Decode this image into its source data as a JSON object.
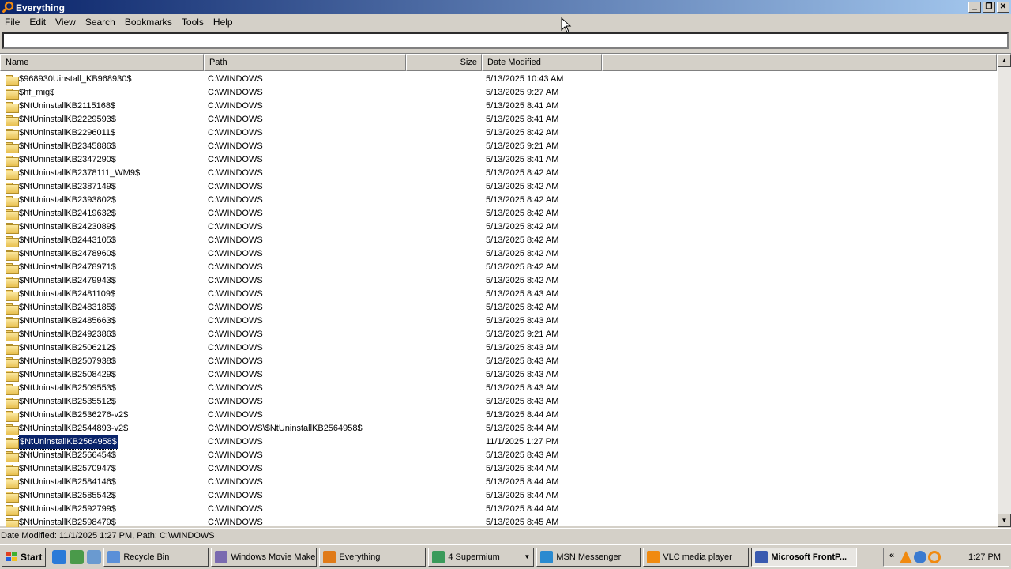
{
  "window": {
    "title": "Everything"
  },
  "menu": [
    "File",
    "Edit",
    "View",
    "Search",
    "Bookmarks",
    "Tools",
    "Help"
  ],
  "search": {
    "value": "",
    "placeholder": ""
  },
  "columns": {
    "name": "Name",
    "path": "Path",
    "size": "Size",
    "date": "Date Modified"
  },
  "rows": [
    {
      "name": "$968930Uinstall_KB968930$",
      "path": "C:\\WINDOWS",
      "date": "5/13/2025 10:43 AM"
    },
    {
      "name": "$hf_mig$",
      "path": "C:\\WINDOWS",
      "date": "5/13/2025 9:27 AM"
    },
    {
      "name": "$NtUninstallKB2115168$",
      "path": "C:\\WINDOWS",
      "date": "5/13/2025 8:41 AM"
    },
    {
      "name": "$NtUninstallKB2229593$",
      "path": "C:\\WINDOWS",
      "date": "5/13/2025 8:41 AM"
    },
    {
      "name": "$NtUninstallKB2296011$",
      "path": "C:\\WINDOWS",
      "date": "5/13/2025 8:42 AM"
    },
    {
      "name": "$NtUninstallKB2345886$",
      "path": "C:\\WINDOWS",
      "date": "5/13/2025 9:21 AM"
    },
    {
      "name": "$NtUninstallKB2347290$",
      "path": "C:\\WINDOWS",
      "date": "5/13/2025 8:41 AM"
    },
    {
      "name": "$NtUninstallKB2378111_WM9$",
      "path": "C:\\WINDOWS",
      "date": "5/13/2025 8:42 AM"
    },
    {
      "name": "$NtUninstallKB2387149$",
      "path": "C:\\WINDOWS",
      "date": "5/13/2025 8:42 AM"
    },
    {
      "name": "$NtUninstallKB2393802$",
      "path": "C:\\WINDOWS",
      "date": "5/13/2025 8:42 AM"
    },
    {
      "name": "$NtUninstallKB2419632$",
      "path": "C:\\WINDOWS",
      "date": "5/13/2025 8:42 AM"
    },
    {
      "name": "$NtUninstallKB2423089$",
      "path": "C:\\WINDOWS",
      "date": "5/13/2025 8:42 AM"
    },
    {
      "name": "$NtUninstallKB2443105$",
      "path": "C:\\WINDOWS",
      "date": "5/13/2025 8:42 AM"
    },
    {
      "name": "$NtUninstallKB2478960$",
      "path": "C:\\WINDOWS",
      "date": "5/13/2025 8:42 AM"
    },
    {
      "name": "$NtUninstallKB2478971$",
      "path": "C:\\WINDOWS",
      "date": "5/13/2025 8:42 AM"
    },
    {
      "name": "$NtUninstallKB2479943$",
      "path": "C:\\WINDOWS",
      "date": "5/13/2025 8:42 AM"
    },
    {
      "name": "$NtUninstallKB2481109$",
      "path": "C:\\WINDOWS",
      "date": "5/13/2025 8:43 AM"
    },
    {
      "name": "$NtUninstallKB2483185$",
      "path": "C:\\WINDOWS",
      "date": "5/13/2025 8:42 AM"
    },
    {
      "name": "$NtUninstallKB2485663$",
      "path": "C:\\WINDOWS",
      "date": "5/13/2025 8:43 AM"
    },
    {
      "name": "$NtUninstallKB2492386$",
      "path": "C:\\WINDOWS",
      "date": "5/13/2025 9:21 AM"
    },
    {
      "name": "$NtUninstallKB2506212$",
      "path": "C:\\WINDOWS",
      "date": "5/13/2025 8:43 AM"
    },
    {
      "name": "$NtUninstallKB2507938$",
      "path": "C:\\WINDOWS",
      "date": "5/13/2025 8:43 AM"
    },
    {
      "name": "$NtUninstallKB2508429$",
      "path": "C:\\WINDOWS",
      "date": "5/13/2025 8:43 AM"
    },
    {
      "name": "$NtUninstallKB2509553$",
      "path": "C:\\WINDOWS",
      "date": "5/13/2025 8:43 AM"
    },
    {
      "name": "$NtUninstallKB2535512$",
      "path": "C:\\WINDOWS",
      "date": "5/13/2025 8:43 AM"
    },
    {
      "name": "$NtUninstallKB2536276-v2$",
      "path": "C:\\WINDOWS",
      "date": "5/13/2025 8:44 AM"
    },
    {
      "name": "$NtUninstallKB2544893-v2$",
      "path": "C:\\WINDOWS\\$NtUninstallKB2564958$",
      "date": "5/13/2025 8:44 AM"
    },
    {
      "name": "$NtUninstallKB2564958$",
      "path": "C:\\WINDOWS",
      "date": "11/1/2025 1:27 PM",
      "selected": true
    },
    {
      "name": "$NtUninstallKB2566454$",
      "path": "C:\\WINDOWS",
      "date": "5/13/2025 8:43 AM"
    },
    {
      "name": "$NtUninstallKB2570947$",
      "path": "C:\\WINDOWS",
      "date": "5/13/2025 8:44 AM"
    },
    {
      "name": "$NtUninstallKB2584146$",
      "path": "C:\\WINDOWS",
      "date": "5/13/2025 8:44 AM"
    },
    {
      "name": "$NtUninstallKB2585542$",
      "path": "C:\\WINDOWS",
      "date": "5/13/2025 8:44 AM"
    },
    {
      "name": "$NtUninstallKB2592799$",
      "path": "C:\\WINDOWS",
      "date": "5/13/2025 8:44 AM"
    },
    {
      "name": "$NtUninstallKB2598479$",
      "path": "C:\\WINDOWS",
      "date": "5/13/2025 8:45 AM"
    }
  ],
  "status": "Date Modified: 11/1/2025 1:27 PM, Path: C:\\WINDOWS",
  "taskbar": {
    "start": "Start",
    "tasks": [
      {
        "label": "Recycle Bin",
        "icon": "recycle-bin-icon",
        "color": "#5a8fd8",
        "width": 133
      },
      {
        "label": "Windows Movie Maker",
        "icon": "movie-maker-icon",
        "color": "#7a6ab0",
        "width": 134
      },
      {
        "label": "Everything",
        "icon": "everything-icon",
        "color": "#e07a18",
        "width": 135
      },
      {
        "label": "4 Supermium",
        "icon": "supermium-icon",
        "color": "#3a9a5a",
        "width": 134,
        "dropdown": true
      },
      {
        "label": "MSN Messenger",
        "icon": "msn-icon",
        "color": "#2a8ad0",
        "width": 132
      },
      {
        "label": "VLC media player",
        "icon": "vlc-icon",
        "color": "#f08a10",
        "width": 134
      },
      {
        "label": "Microsoft FrontP...",
        "icon": "frontpage-icon",
        "color": "#3a5ab0",
        "width": 134,
        "active": true
      }
    ],
    "clock": "1:27 PM"
  },
  "colors": {
    "titlebar_start": "#0a246a",
    "titlebar_end": "#a6caf0",
    "selection": "#0a246a"
  }
}
